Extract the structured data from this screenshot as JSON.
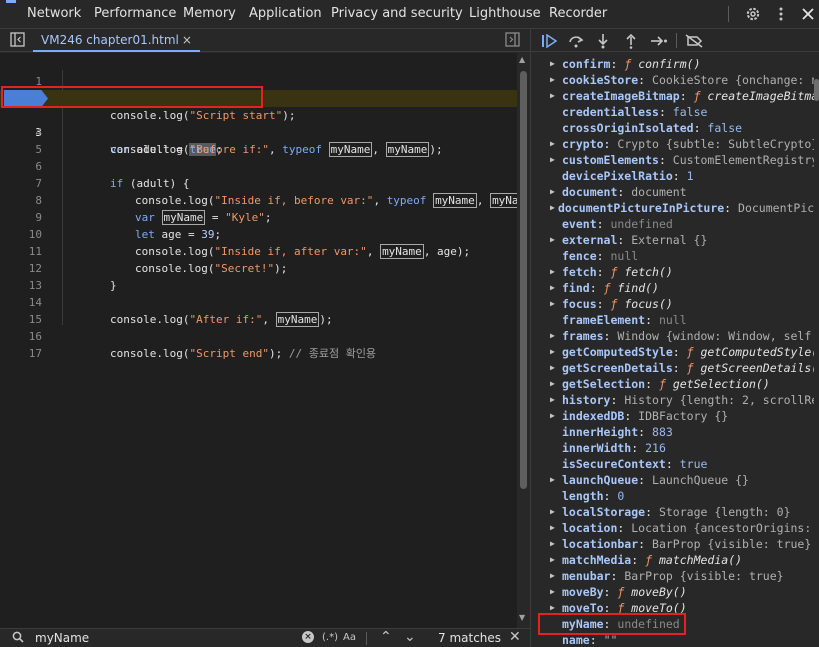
{
  "top_tabs": [
    "Network",
    "Performance",
    "Memory",
    "Application",
    "Privacy and security",
    "Lighthouse",
    "Recorder"
  ],
  "top_icons": {
    "settings": "gear-icon",
    "more": "kebab-icon",
    "close": "close-icon"
  },
  "file_tab": {
    "label": "VM246 chapter01.html",
    "close": "×"
  },
  "code_lines": [
    {
      "n": "1"
    },
    {
      "n": "2"
    },
    {
      "n": "3"
    },
    {
      "n": "4"
    },
    {
      "n": "5"
    },
    {
      "n": "6"
    },
    {
      "n": "7"
    },
    {
      "n": "8"
    },
    {
      "n": "9"
    },
    {
      "n": "10"
    },
    {
      "n": "11"
    },
    {
      "n": "12"
    },
    {
      "n": "13"
    },
    {
      "n": "14"
    },
    {
      "n": "15"
    },
    {
      "n": "16"
    },
    {
      "n": "17"
    }
  ],
  "code": {
    "l2": {
      "a": "console.",
      "b": "log",
      "c": "(",
      "d": "\"Script start\"",
      "e": ");"
    },
    "l3": {
      "a": "var",
      "b": " adult ",
      "c": "= ",
      "d": "true",
      "e": ";"
    },
    "l4": {
      "a": "console.",
      "b": "log",
      "c": "(",
      "d": "\"Before if:\"",
      "e": ", ",
      "f": "typeof",
      "g": " ",
      "h": "myName",
      "i": ", ",
      "j": "myName",
      "k": ");"
    },
    "l6": {
      "a": "if",
      "b": " (adult) {"
    },
    "l7": {
      "a": "console.",
      "b": "log",
      "c": "(",
      "d": "\"Inside if, before var:\"",
      "e": ", ",
      "f": "typeof",
      "g": " ",
      "h": "myName",
      "i": ", ",
      "j": "myName",
      "k": ");"
    },
    "l8": {
      "a": "var",
      "b": " ",
      "c": "myName",
      "d": " = ",
      "e": "\"Kyle\"",
      "f": ";"
    },
    "l9": {
      "a": "let",
      "b": " age ",
      "c": "= ",
      "d": "39",
      "e": ";"
    },
    "l10": {
      "a": "console.",
      "b": "log",
      "c": "(",
      "d": "\"Inside if, after var:\"",
      "e": ", ",
      "f": "myName",
      "g": ", age);"
    },
    "l11": {
      "a": "console.",
      "b": "log",
      "c": "(",
      "d": "\"Secret!\"",
      "e": ");"
    },
    "l12": {
      "a": "}"
    },
    "l14": {
      "a": "console.",
      "b": "log",
      "c": "(",
      "d": "\"After if:\"",
      "e": ", ",
      "f": "myName",
      "g": ");"
    },
    "l16": {
      "a": "console.",
      "b": "log",
      "c": "(",
      "d": "\"Script end\"",
      "e": "); ",
      "f": "// 종료점 확인용"
    }
  },
  "debugger_buttons": [
    "resume-icon",
    "step-over-icon",
    "step-into-icon",
    "step-out-icon",
    "step-icon",
    "deactivate-breakpoints-icon"
  ],
  "properties": [
    {
      "name": "confirm",
      "expand": true,
      "val": "confirm()",
      "kind": "fn"
    },
    {
      "name": "cookieStore",
      "expand": true,
      "val": "CookieStore {onchange: null}",
      "kind": "obj"
    },
    {
      "name": "createImageBitmap",
      "expand": true,
      "val": "createImageBitmap()",
      "kind": "fn"
    },
    {
      "name": "credentialless",
      "expand": false,
      "val": "false",
      "kind": "bool"
    },
    {
      "name": "crossOriginIsolated",
      "expand": false,
      "val": "false",
      "kind": "bool"
    },
    {
      "name": "crypto",
      "expand": true,
      "val": "Crypto {subtle: SubtleCrypto}",
      "kind": "obj"
    },
    {
      "name": "customElements",
      "expand": true,
      "val": "CustomElementRegistry {}",
      "kind": "obj"
    },
    {
      "name": "devicePixelRatio",
      "expand": false,
      "val": "1",
      "kind": "num"
    },
    {
      "name": "document",
      "expand": true,
      "val": "document",
      "kind": "obj"
    },
    {
      "name": "documentPictureInPicture",
      "expand": true,
      "val": "DocumentPictureInPicture",
      "kind": "obj"
    },
    {
      "name": "event",
      "expand": false,
      "val": "undefined",
      "kind": "undef"
    },
    {
      "name": "external",
      "expand": true,
      "val": "External {}",
      "kind": "obj"
    },
    {
      "name": "fence",
      "expand": false,
      "val": "null",
      "kind": "undef"
    },
    {
      "name": "fetch",
      "expand": true,
      "val": "fetch()",
      "kind": "fn"
    },
    {
      "name": "find",
      "expand": true,
      "val": "find()",
      "kind": "fn"
    },
    {
      "name": "focus",
      "expand": true,
      "val": "focus()",
      "kind": "fn"
    },
    {
      "name": "frameElement",
      "expand": false,
      "val": "null",
      "kind": "undef"
    },
    {
      "name": "frames",
      "expand": true,
      "val": "Window {window: Window, self: Window}",
      "kind": "obj"
    },
    {
      "name": "getComputedStyle",
      "expand": true,
      "val": "getComputedStyle()",
      "kind": "fn"
    },
    {
      "name": "getScreenDetails",
      "expand": true,
      "val": "getScreenDetails()",
      "kind": "fn"
    },
    {
      "name": "getSelection",
      "expand": true,
      "val": "getSelection()",
      "kind": "fn"
    },
    {
      "name": "history",
      "expand": true,
      "val": "History {length: 2, scrollRestoration}",
      "kind": "obj"
    },
    {
      "name": "indexedDB",
      "expand": true,
      "val": "IDBFactory {}",
      "kind": "obj"
    },
    {
      "name": "innerHeight",
      "expand": false,
      "val": "883",
      "kind": "num"
    },
    {
      "name": "innerWidth",
      "expand": false,
      "val": "216",
      "kind": "num"
    },
    {
      "name": "isSecureContext",
      "expand": false,
      "val": "true",
      "kind": "bool"
    },
    {
      "name": "launchQueue",
      "expand": true,
      "val": "LaunchQueue {}",
      "kind": "obj"
    },
    {
      "name": "length",
      "expand": false,
      "val": "0",
      "kind": "num"
    },
    {
      "name": "localStorage",
      "expand": true,
      "val": "Storage {length: 0}",
      "kind": "obj"
    },
    {
      "name": "location",
      "expand": true,
      "val": "Location {ancestorOrigins: DOMStringList}",
      "kind": "obj"
    },
    {
      "name": "locationbar",
      "expand": true,
      "val": "BarProp {visible: true}",
      "kind": "obj"
    },
    {
      "name": "matchMedia",
      "expand": true,
      "val": "matchMedia()",
      "kind": "fn"
    },
    {
      "name": "menubar",
      "expand": true,
      "val": "BarProp {visible: true}",
      "kind": "obj"
    },
    {
      "name": "moveBy",
      "expand": true,
      "val": "moveBy()",
      "kind": "fn"
    },
    {
      "name": "moveTo",
      "expand": true,
      "val": "moveTo()",
      "kind": "fn"
    },
    {
      "name": "myName",
      "expand": false,
      "val": "undefined",
      "kind": "undef"
    },
    {
      "name": "name",
      "expand": false,
      "val": "\"\"",
      "kind": "obj"
    }
  ],
  "search": {
    "query": "myName",
    "regex": "(.*)",
    "case": "Aa",
    "count": "7 matches"
  },
  "colors": {
    "accent": "#7cacf8",
    "highlight_box": "#e52222",
    "paused_line": "#3a3311"
  }
}
